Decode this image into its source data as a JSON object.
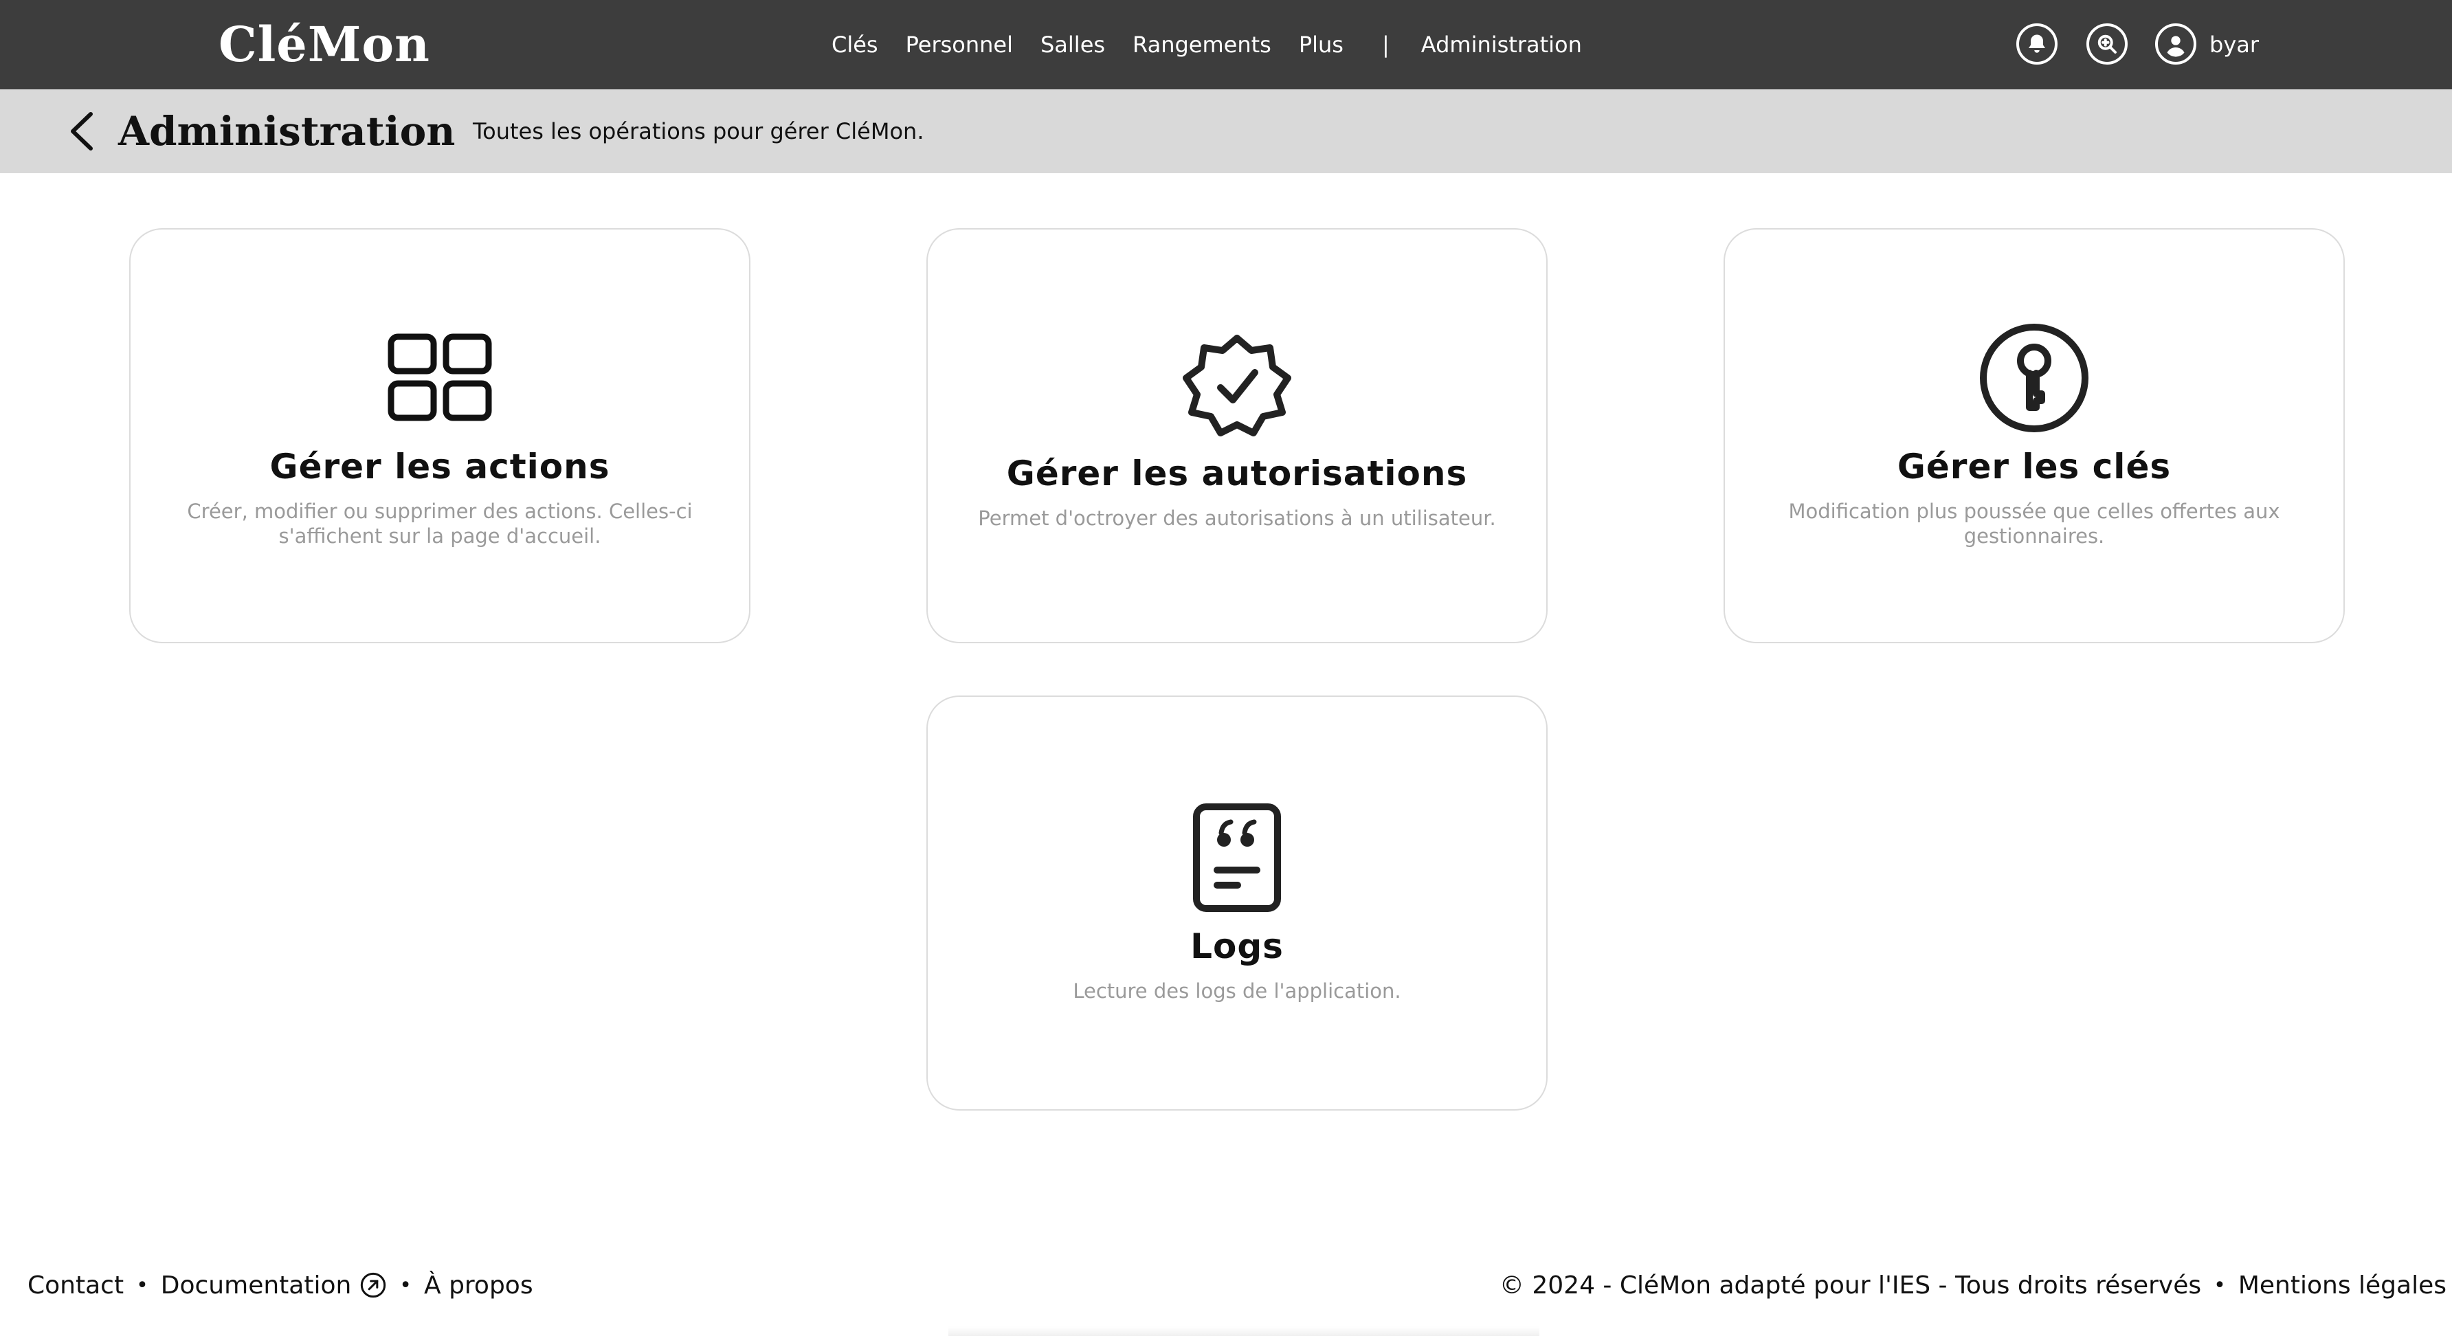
{
  "app": {
    "logo": "CléMon"
  },
  "nav": {
    "items": [
      "Clés",
      "Personnel",
      "Salles",
      "Rangements",
      "Plus"
    ],
    "separator": "|",
    "admin_label": "Administration"
  },
  "user": {
    "name": "byar"
  },
  "icons": {
    "notifications": "bell-icon",
    "search": "zoom-search-icon",
    "user": "user-circle-icon",
    "back": "chevron-left-icon"
  },
  "page": {
    "title": "Administration",
    "description": "Toutes les opérations pour gérer CléMon."
  },
  "cards": [
    {
      "icon": "grid-icon",
      "title": "Gérer les actions",
      "description": "Créer, modifier ou supprimer des actions. Celles-ci s'affichent sur la page d'accueil."
    },
    {
      "icon": "verified-badge-icon",
      "title": "Gérer les autorisations",
      "description": "Permet d'octroyer des autorisations à un utilisateur."
    },
    {
      "icon": "key-circle-icon",
      "title": "Gérer les clés",
      "description": "Modification plus poussée que celles offertes aux gestionnaires."
    },
    {
      "icon": "quote-document-icon",
      "title": "Logs",
      "description": "Lecture des logs de l'application."
    }
  ],
  "footer": {
    "contact": "Contact",
    "documentation": "Documentation",
    "about": "À propos",
    "separator": "•",
    "copyright": "© 2024 - CléMon adapté pour l'IES - Tous droits réservés",
    "legal": "Mentions légales"
  },
  "colors": {
    "topbar": "#3d3d3d",
    "subheader": "#d9d9d9",
    "card_border": "#dcdcdc",
    "muted_text": "#9a9a9a"
  }
}
